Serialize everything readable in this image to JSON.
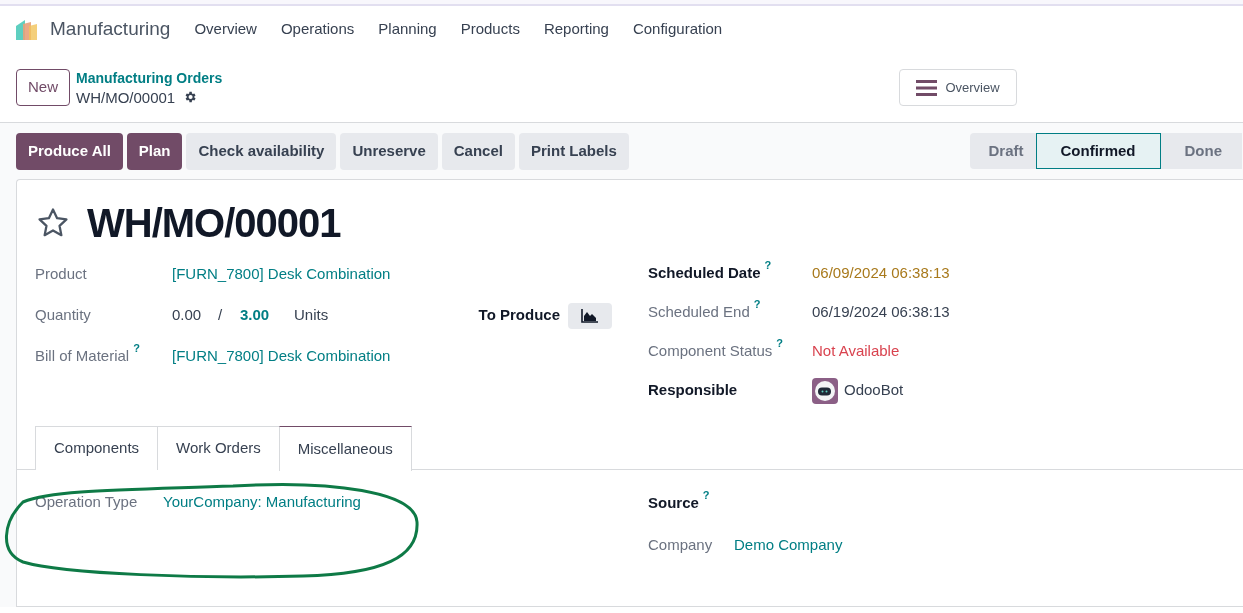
{
  "app": {
    "name": "Manufacturing",
    "menu": [
      "Overview",
      "Operations",
      "Planning",
      "Products",
      "Reporting",
      "Configuration"
    ]
  },
  "control_panel": {
    "new_button": "New",
    "breadcrumb_parent": "Manufacturing Orders",
    "breadcrumb_current": "WH/MO/00001",
    "overview_button": "Overview"
  },
  "action_buttons": [
    {
      "label": "Produce All",
      "primary": true
    },
    {
      "label": "Plan",
      "primary": true
    },
    {
      "label": "Check availability",
      "primary": false
    },
    {
      "label": "Unreserve",
      "primary": false
    },
    {
      "label": "Cancel",
      "primary": false
    },
    {
      "label": "Print Labels",
      "primary": false
    }
  ],
  "statusbar": [
    {
      "label": "Draft",
      "selected": false
    },
    {
      "label": "Confirmed",
      "selected": true
    },
    {
      "label": "Done",
      "selected": false
    }
  ],
  "record": {
    "starred": false,
    "title": "WH/MO/00001"
  },
  "left_fields": [
    {
      "kind": "link",
      "label": "Product",
      "help": false,
      "value": "[FURN_7800] Desk Combination"
    },
    {
      "kind": "quantity",
      "label": "Quantity",
      "help": false,
      "produced": "0.00",
      "separator": "/",
      "planned": "3.00",
      "uom": "Units",
      "side_label": "To Produce"
    },
    {
      "kind": "link",
      "label": "Bill of Material",
      "help": true,
      "value": "[FURN_7800] Desk Combination"
    }
  ],
  "right_fields": [
    {
      "kind": "warning",
      "label": "Scheduled Date",
      "required": true,
      "help": true,
      "value": "06/09/2024 06:38:13"
    },
    {
      "kind": "text",
      "label": "Scheduled End",
      "required": false,
      "help": true,
      "value": "06/19/2024 06:38:13"
    },
    {
      "kind": "danger",
      "label": "Component Status",
      "required": false,
      "help": true,
      "value": "Not Available"
    },
    {
      "kind": "avatar",
      "label": "Responsible",
      "required": true,
      "help": false,
      "value": "OdooBot"
    }
  ],
  "tabs": [
    {
      "label": "Components",
      "selected": false
    },
    {
      "label": "Work Orders",
      "selected": false
    },
    {
      "label": "Miscellaneous",
      "selected": true
    }
  ],
  "misc_left": [
    {
      "kind": "link",
      "label": "Operation Type",
      "required": false,
      "help": false,
      "value": "YourCompany: Manufacturing"
    }
  ],
  "misc_right": [
    {
      "kind": "empty",
      "label": "Source",
      "required": true,
      "help": true
    },
    {
      "kind": "link",
      "label": "Company",
      "required": false,
      "help": false,
      "value": "Demo Company"
    }
  ],
  "help_mark": "?"
}
